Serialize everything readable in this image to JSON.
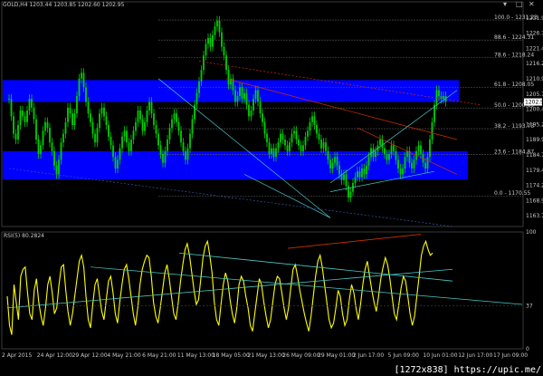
{
  "window": {
    "symbol_label": "GOLD,H4  1203.44 1203.85 1202.60 1202.95",
    "controls": [
      "▾",
      "□",
      "✕"
    ]
  },
  "watermark": "[1272x838] https://upic.me/",
  "colors": {
    "background": "#000000",
    "candle": "#00d000",
    "zone": "#0000ff",
    "rsi_line": "#ffff00",
    "trend_red": "#cc3300",
    "trend_cyan": "#48c8c8",
    "fib": "#5a5a5a"
  },
  "chart_data": [
    {
      "type": "line",
      "name": "price",
      "y_ticks": [
        "1231.95",
        "1226.70",
        "1221.45",
        "1216.20",
        "1210.95",
        "1205.70",
        "1200.45",
        "1195.20",
        "1189.95",
        "1184.70",
        "1179.45",
        "1174.20",
        "1168.95",
        "1163.70"
      ],
      "price_marker": "1202.95",
      "fib_levels": [
        {
          "label": "100.0 - 1231.23",
          "price": 1231.23
        },
        {
          "label": "88.6 - 1224.31",
          "price": 1224.31
        },
        {
          "label": "78.6 - 1218.24",
          "price": 1218.24
        },
        {
          "label": "61.8 - 1208.05",
          "price": 1208.05
        },
        {
          "label": "50.0 - 1200.89",
          "price": 1200.89
        },
        {
          "label": "38.2 - 1193.73",
          "price": 1193.73
        },
        {
          "label": "23.6 - 1184.87",
          "price": 1184.87
        },
        {
          "label": "0.0 - 1170.55",
          "price": 1170.55
        }
      ],
      "zones": [
        {
          "from": 1202.95,
          "to": 1210.5
        },
        {
          "from": 1176.2,
          "to": 1186.0
        }
      ],
      "ylim": [
        1160.0,
        1235.0
      ],
      "close": [
        1204,
        1198,
        1192,
        1190,
        1195,
        1200,
        1198,
        1196,
        1200,
        1204,
        1201,
        1197,
        1190,
        1185,
        1188,
        1193,
        1196,
        1194,
        1189,
        1186,
        1181,
        1178,
        1183,
        1189,
        1192,
        1196,
        1201,
        1199,
        1195,
        1199,
        1205,
        1211,
        1213,
        1208,
        1203,
        1199,
        1196,
        1192,
        1189,
        1194,
        1199,
        1201,
        1198,
        1195,
        1191,
        1188,
        1184,
        1180,
        1183,
        1187,
        1191,
        1193,
        1189,
        1186,
        1190,
        1193,
        1196,
        1200,
        1197,
        1193,
        1196,
        1200,
        1203,
        1199,
        1195,
        1192,
        1188,
        1185,
        1182,
        1186,
        1190,
        1194,
        1197,
        1199,
        1196,
        1193,
        1189,
        1186,
        1183,
        1187,
        1192,
        1197,
        1202,
        1206,
        1210,
        1214,
        1219,
        1223,
        1225,
        1222,
        1226,
        1229,
        1231,
        1227,
        1222,
        1219,
        1214,
        1209,
        1211,
        1207,
        1203,
        1205,
        1208,
        1204,
        1206,
        1202,
        1198,
        1200,
        1204,
        1207,
        1203,
        1199,
        1196,
        1192,
        1189,
        1185,
        1187,
        1184,
        1187,
        1189,
        1192,
        1190,
        1188,
        1186,
        1189,
        1192,
        1193,
        1190,
        1188,
        1186,
        1188,
        1191,
        1193,
        1196,
        1198,
        1195,
        1192,
        1190,
        1187,
        1189,
        1186,
        1183,
        1180,
        1182,
        1184,
        1181,
        1178,
        1176,
        1178,
        1174,
        1170,
        1172,
        1175,
        1177,
        1179,
        1177,
        1180,
        1178,
        1181,
        1184,
        1187,
        1184,
        1186,
        1188,
        1190,
        1187,
        1185,
        1183,
        1185,
        1188,
        1186,
        1183,
        1180,
        1178,
        1180,
        1184,
        1186,
        1182,
        1180,
        1183,
        1186,
        1188,
        1185,
        1182,
        1180,
        1184,
        1190,
        1196,
        1202,
        1207,
        1205,
        1204,
        1205,
        1203
      ]
    },
    {
      "type": "line",
      "name": "rsi",
      "label": "RSI(5) 80.2824",
      "y_ticks": [
        "100",
        "37",
        "0"
      ],
      "ylim": [
        0,
        100
      ],
      "values": [
        45,
        20,
        12,
        55,
        40,
        25,
        62,
        68,
        70,
        48,
        30,
        25,
        50,
        60,
        40,
        28,
        20,
        35,
        55,
        62,
        48,
        30,
        35,
        55,
        70,
        72,
        50,
        32,
        20,
        30,
        45,
        60,
        75,
        80,
        70,
        45,
        25,
        18,
        38,
        55,
        60,
        45,
        32,
        25,
        42,
        58,
        62,
        48,
        30,
        22,
        40,
        55,
        68,
        72,
        60,
        45,
        30,
        20,
        35,
        55,
        68,
        75,
        80,
        78,
        62,
        40,
        28,
        22,
        35,
        50,
        65,
        72,
        60,
        45,
        30,
        25,
        40,
        58,
        72,
        85,
        90,
        80,
        65,
        50,
        38,
        42,
        60,
        78,
        88,
        92,
        80,
        65,
        40,
        25,
        20,
        38,
        55,
        65,
        58,
        42,
        30,
        22,
        35,
        55,
        62,
        58,
        45,
        35,
        20,
        15,
        30,
        45,
        60,
        55,
        40,
        28,
        18,
        25,
        40,
        55,
        62,
        60,
        48,
        35,
        25,
        35,
        52,
        68,
        72,
        62,
        50,
        40,
        30,
        22,
        15,
        28,
        45,
        62,
        75,
        80,
        70,
        55,
        40,
        25,
        18,
        22,
        35,
        50,
        45,
        30,
        20,
        25,
        42,
        55,
        48,
        35,
        25,
        38,
        55,
        68,
        75,
        62,
        50,
        40,
        32,
        45,
        60,
        70,
        78,
        72,
        60,
        45,
        30,
        25,
        38,
        52,
        62,
        58,
        45,
        30,
        20,
        28,
        45,
        62,
        80,
        88,
        92,
        85,
        80,
        82
      ]
    }
  ],
  "x_labels": [
    "2 Apr 2015",
    "24 Apr 12:00",
    "29 Apr 12:00",
    "4 May 21:00",
    "6 May 21:00",
    "11 May 13:00",
    "18 May 05:00",
    "21 May 13:00",
    "26 May 09:00",
    "29 May 01:00",
    "2 Jun 17:00",
    "5 Jun 09:00",
    "10 Jun 01:00",
    "12 Jun 17:00",
    "17 Jun 09:00"
  ]
}
